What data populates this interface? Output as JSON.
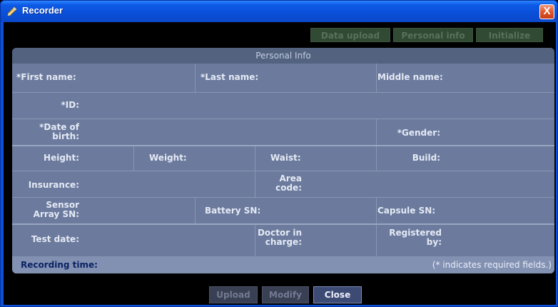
{
  "window": {
    "title": "Recorder",
    "close_glyph": "X"
  },
  "toolbar": {
    "data_upload": "Data upload",
    "personal_info": "Personal info",
    "initialize": "Initialize"
  },
  "panel": {
    "header": "Personal Info",
    "fields": {
      "first_name": "*First name:",
      "last_name": "*Last name:",
      "middle_name": "Middle name:",
      "id": "*ID:",
      "dob_line1": "*Date of",
      "dob_line2": "birth:",
      "gender": "*Gender:",
      "height": "Height:",
      "weight": "Weight:",
      "waist": "Waist:",
      "build": "Build:",
      "insurance": "Insurance:",
      "area_code_line1": "Area",
      "area_code_line2": "code:",
      "sensor_line1": "Sensor",
      "sensor_line2": "Array SN:",
      "battery_sn": "Battery SN:",
      "capsule_sn": "Capsule SN:",
      "test_date": "Test date:",
      "doctor_line1": "Doctor in",
      "doctor_line2": "charge:",
      "registered_line1": "Registered",
      "registered_line2": "by:"
    },
    "recording_time": "Recording time:",
    "required_note": "(* indicates required fields.)"
  },
  "buttons": {
    "upload": "Upload",
    "modify": "Modify",
    "close": "Close"
  },
  "colors": {
    "title_bar": "#0a4fd8",
    "panel_bg": "#6b7a9d",
    "panel_header": "#52627f",
    "recording_time_text": "#0b2363"
  }
}
